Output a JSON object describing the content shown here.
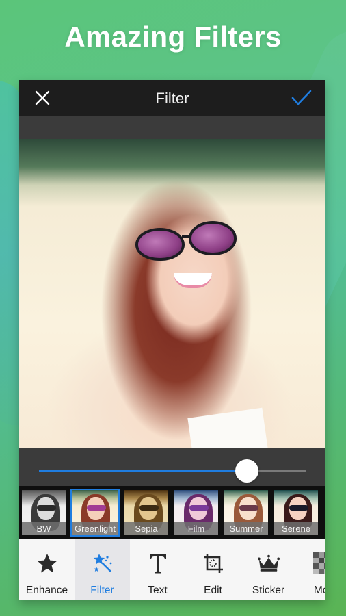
{
  "headline": {
    "regular": "Amazing",
    "bold": "Filters"
  },
  "colors": {
    "accent": "#1f7de0",
    "background_green": "#5bc57a",
    "topbar": "#1d1d1d",
    "toolbar": "#f6f6f6"
  },
  "header": {
    "title": "Filter",
    "close_icon": "close-icon",
    "confirm_icon": "checkmark-icon"
  },
  "slider": {
    "value_percent": 78
  },
  "filters": [
    {
      "label": "BW",
      "selected": false
    },
    {
      "label": "Greenlight",
      "selected": true
    },
    {
      "label": "Sepia",
      "selected": false
    },
    {
      "label": "Film",
      "selected": false
    },
    {
      "label": "Summer",
      "selected": false
    },
    {
      "label": "Serene",
      "selected": false
    }
  ],
  "tools": [
    {
      "label": "Enhance",
      "icon": "star-icon",
      "active": false
    },
    {
      "label": "Filter",
      "icon": "magic-wand-icon",
      "active": true
    },
    {
      "label": "Text",
      "icon": "text-icon",
      "active": false
    },
    {
      "label": "Edit",
      "icon": "crop-rotate-icon",
      "active": false
    },
    {
      "label": "Sticker",
      "icon": "crown-icon",
      "active": false
    },
    {
      "label": "Mos",
      "icon": "mosaic-icon",
      "active": false
    }
  ]
}
